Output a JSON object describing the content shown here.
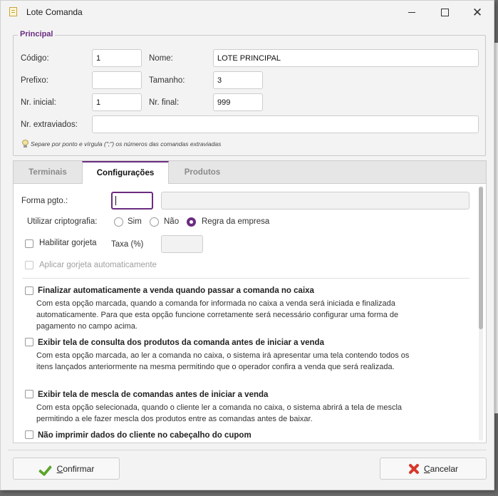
{
  "window": {
    "title": "Lote Comanda"
  },
  "principal": {
    "legend": "Principal",
    "codigo_label": "Código:",
    "codigo_value": "1",
    "nome_label": "Nome:",
    "nome_value": "LOTE PRINCIPAL",
    "prefixo_label": "Prefixo:",
    "prefixo_value": "",
    "tamanho_label": "Tamanho:",
    "tamanho_value": "3",
    "nr_inicial_label": "Nr. inicial:",
    "nr_inicial_value": "1",
    "nr_final_label": "Nr. final:",
    "nr_final_value": "999",
    "nr_extraviados_label": "Nr. extraviados:",
    "nr_extraviados_value": "",
    "hint": "Separe por ponto e vírgula (\";\") os números das comandas extraviadas"
  },
  "tabs": [
    {
      "label": "Terminais",
      "active": false
    },
    {
      "label": "Configurações",
      "active": true
    },
    {
      "label": "Produtos",
      "active": false
    }
  ],
  "config": {
    "forma_pgto_label": "Forma pgto.:",
    "forma_pgto_code": "",
    "forma_pgto_desc": "",
    "cripto_label": "Utilizar criptografia:",
    "cripto_options": [
      "Sim",
      "Não",
      "Regra da empresa"
    ],
    "cripto_selected": "Regra da empresa",
    "gorjeta_label": "Habilitar gorjeta",
    "taxa_label": "Taxa (%)",
    "taxa_value": "",
    "aplicar_gorjeta_label": "Aplicar gorjeta automaticamente",
    "options": [
      {
        "title": "Finalizar automaticamente a venda quando passar a comanda no caixa",
        "desc": "Com esta opção marcada, quando a comanda for informada no caixa a venda será iniciada e finalizada automaticamente. Para que esta opção funcione corretamente será necessário configurar uma forma de pagamento no campo acima."
      },
      {
        "title": "Exibir tela de consulta dos produtos da comanda antes de iniciar a venda",
        "desc": "Com esta opção marcada, ao ler a comanda no caixa, o sistema irá apresentar uma tela contendo todos os itens lançados anteriormente na mesma permitindo que o operador confira a venda que será realizada."
      },
      {
        "title": "Exibir tela de mescla de comandas antes de iniciar a venda",
        "desc": "Com esta opção selecionada, quando o cliente ler a comanda no caixa, o sistema abrirá a tela de mescla  permitindo a ele fazer mescla dos produtos entre as comandas antes de baixar."
      },
      {
        "title": "Não imprimir dados do cliente no cabeçalho do cupom",
        "desc": ""
      }
    ]
  },
  "footer": {
    "confirm_first": "C",
    "confirm_rest": "onfirmar",
    "cancel_first": "C",
    "cancel_rest": "ancelar"
  },
  "colors": {
    "accent": "#6a2c80",
    "confirm_icon": "#5aa52a",
    "cancel_icon": "#d8372c"
  }
}
